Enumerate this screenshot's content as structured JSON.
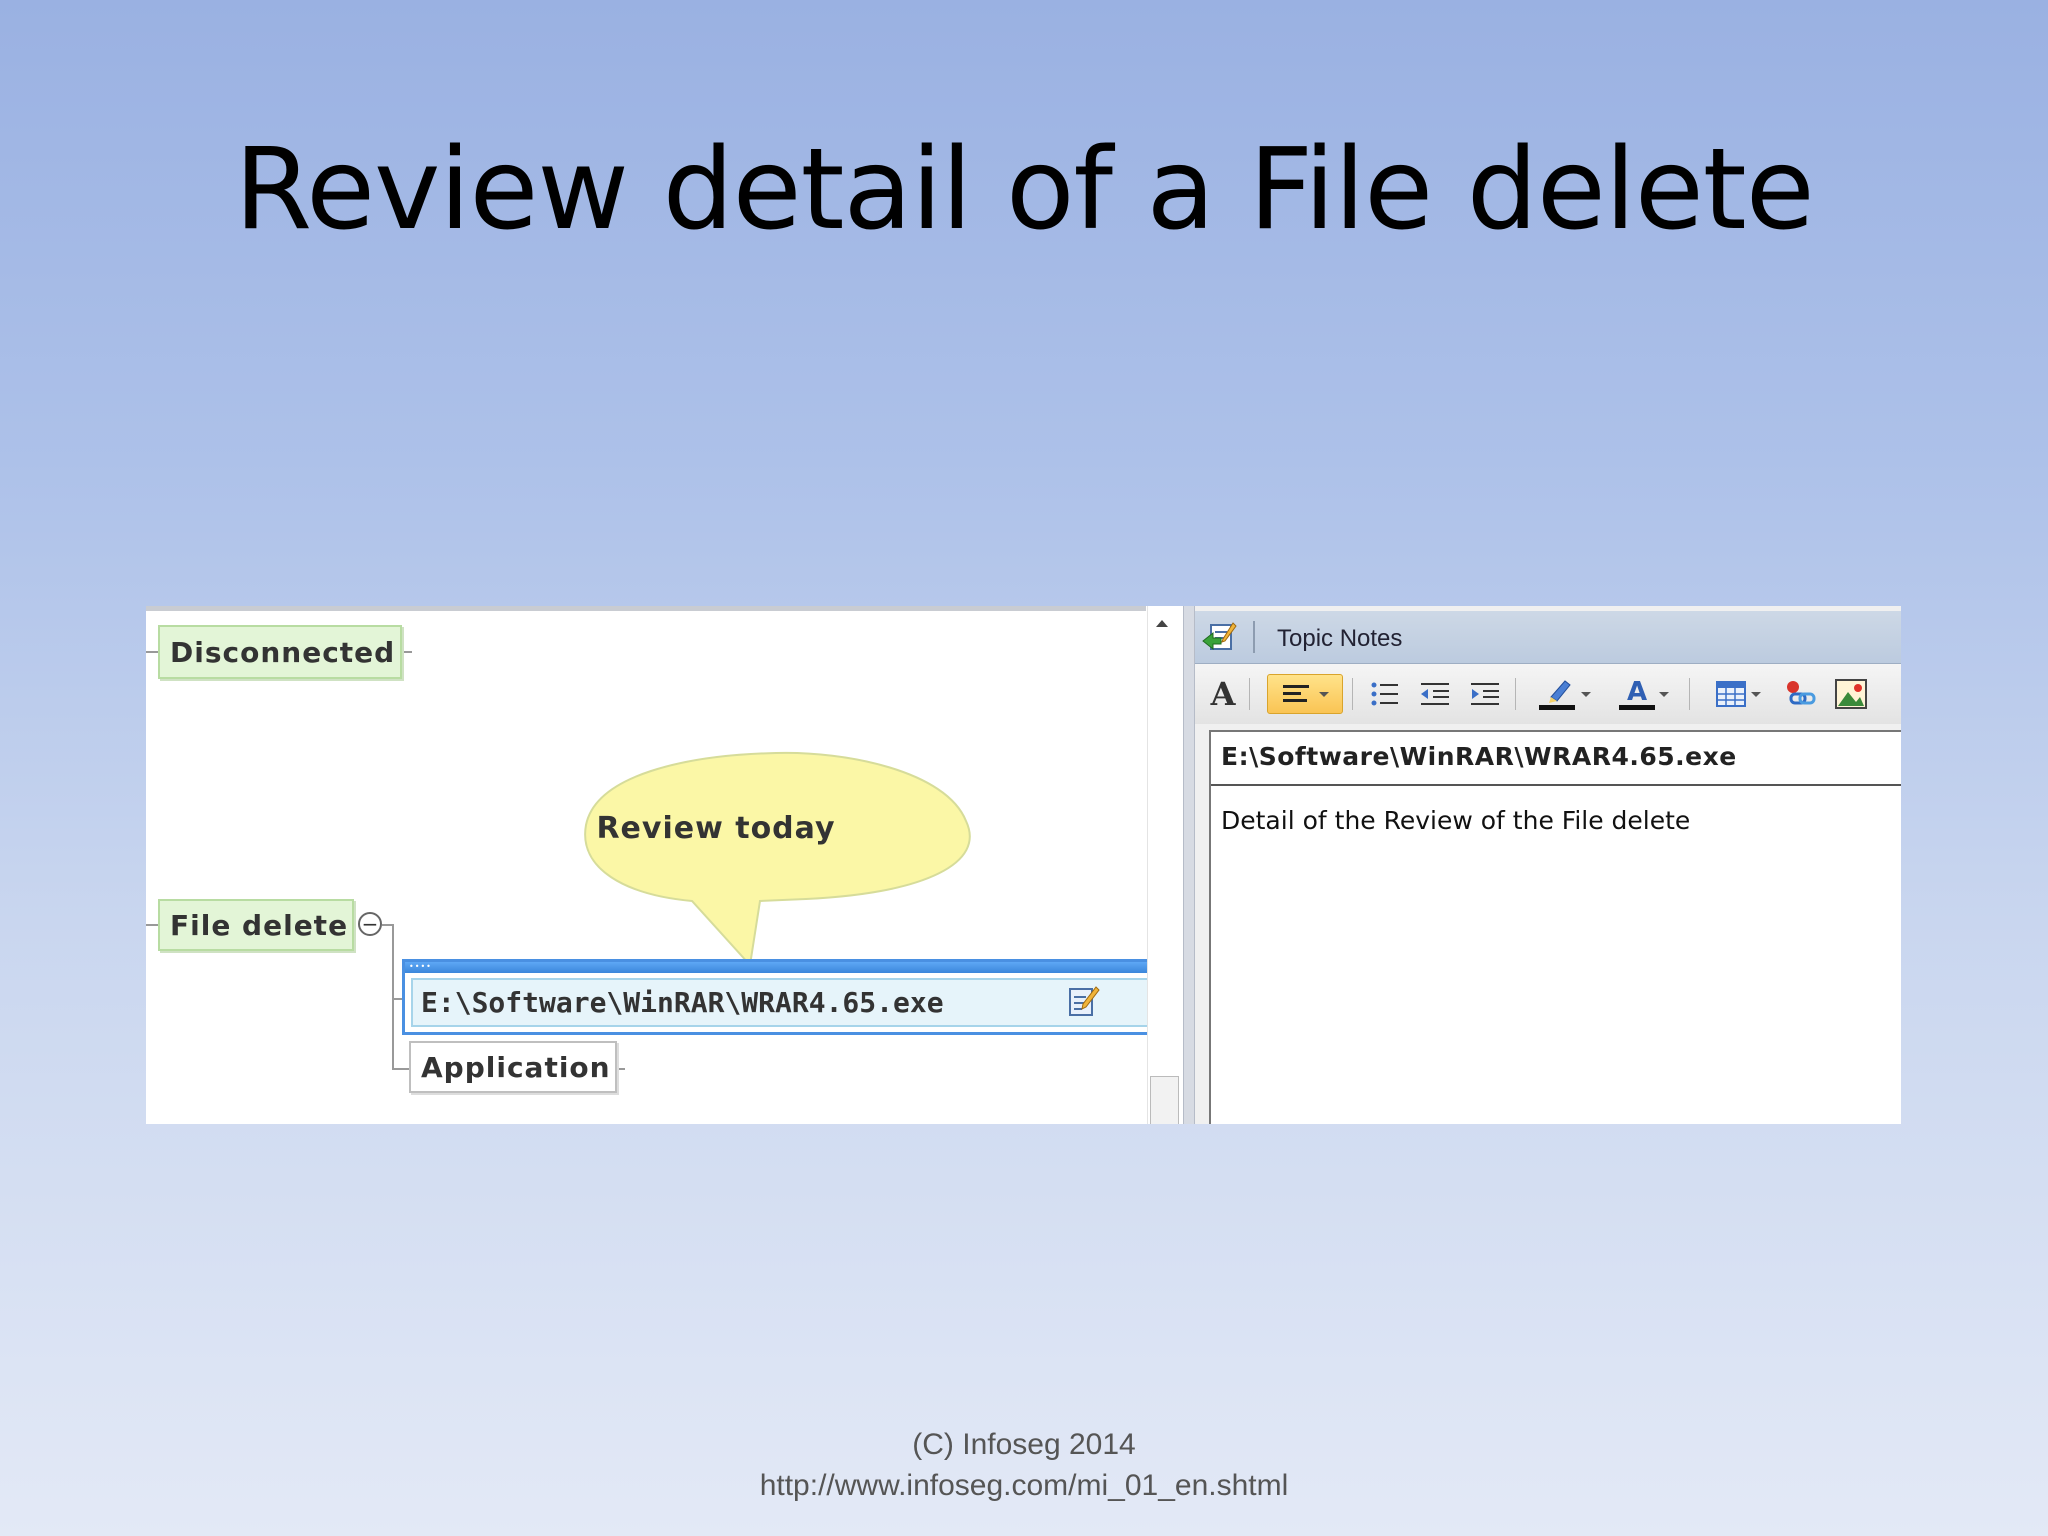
{
  "slide": {
    "title": "Review detail of a File delete",
    "footer_line1": "(C) Infoseg 2014",
    "footer_line2": "http://www.infoseg.com/mi_01_en.shtml"
  },
  "mindmap": {
    "topics": {
      "disconnected": "Disconnected",
      "file_delete": "File delete",
      "selected_path": "E:\\Software\\WinRAR\\WRAR4.65.exe",
      "application": "Application"
    },
    "callout": "Review today",
    "collapse_symbol": "−"
  },
  "notes_pane": {
    "title": "Topic Notes",
    "topic_heading": "E:\\Software\\WinRAR\\WRAR4.65.exe",
    "body_text": "Detail of the Review of the File delete"
  },
  "toolbar": {
    "font_glyph": "A",
    "font_color_glyph": "A",
    "buttons": [
      "font-icon",
      "align-left-icon",
      "bullet-list-icon",
      "decrease-indent-icon",
      "increase-indent-icon",
      "highlight-icon",
      "font-color-icon",
      "table-icon",
      "hyperlink-icon",
      "image-icon"
    ]
  },
  "colors": {
    "topic_green": "#e3f5d7",
    "selection_blue": "#4a90e2",
    "callout_yellow": "#fbf7a6",
    "active_button": "#fac454"
  }
}
